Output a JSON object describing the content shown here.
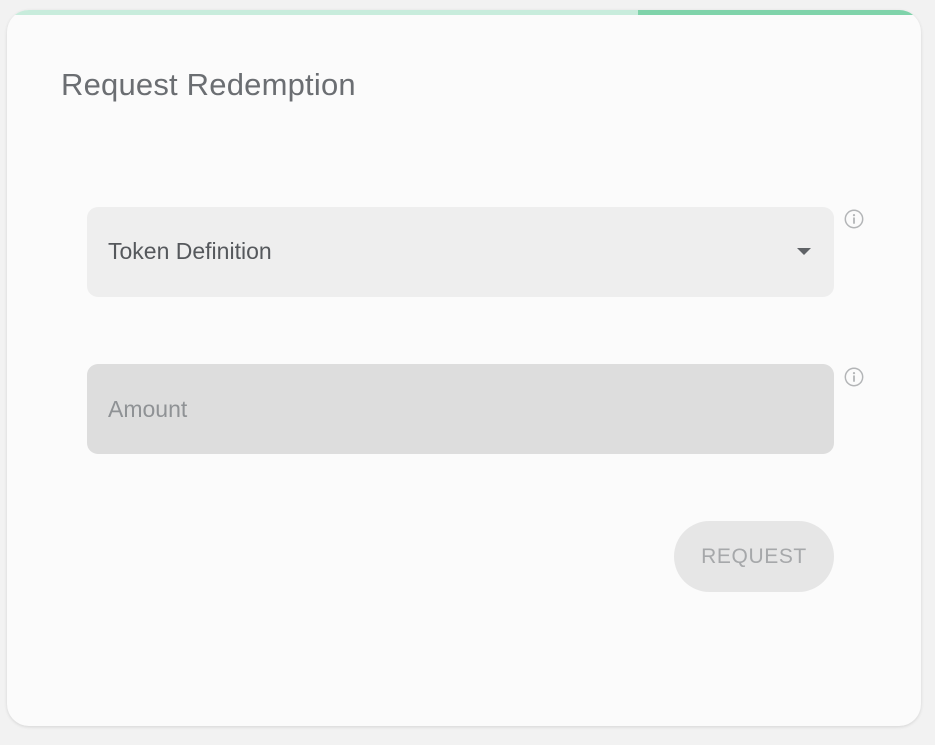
{
  "form": {
    "title": "Request Redemption",
    "progress_fraction": 0.31,
    "token_definition": {
      "label": "Token Definition",
      "selected_value": "",
      "icon": "chevron-down-icon"
    },
    "amount": {
      "placeholder": "Amount",
      "value": ""
    },
    "info_icon": "info-icon",
    "request_button": {
      "label": "REQUEST",
      "disabled": true
    }
  },
  "colors": {
    "accent": "#7fd3aa",
    "accent_light": "#c8ecdc",
    "card_background": "#fbfbfb",
    "select_background": "#eeeeee",
    "input_background": "#dddddd",
    "button_disabled_background": "#e6e6e6",
    "button_disabled_text": "#a6a8aa"
  }
}
